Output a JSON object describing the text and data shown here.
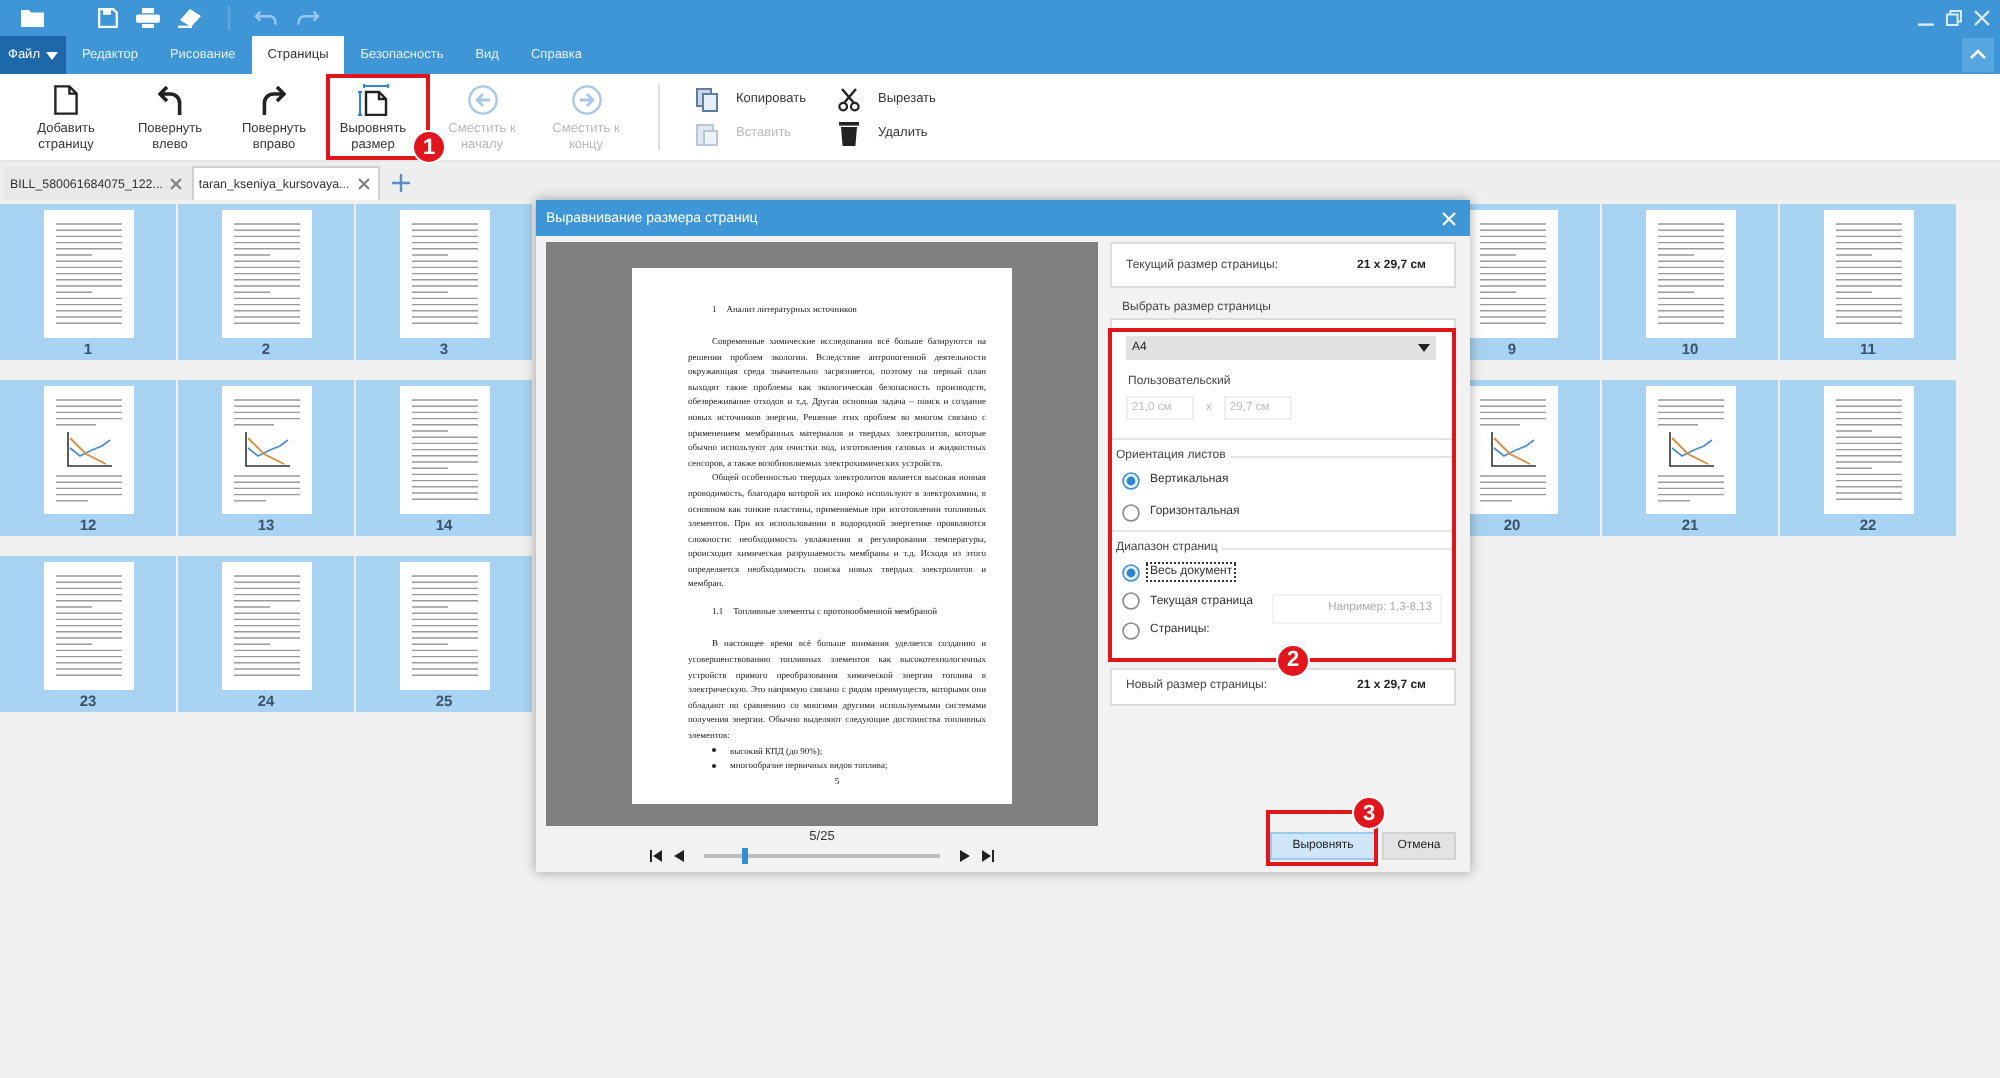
{
  "menu_tabs": [
    {
      "label": "Файл",
      "kind": "file",
      "selected": false
    },
    {
      "label": "Редактор",
      "kind": "tab",
      "selected": false
    },
    {
      "label": "Рисование",
      "kind": "tab",
      "selected": false
    },
    {
      "label": "Страницы",
      "kind": "tab",
      "selected": true
    },
    {
      "label": "Безопасность",
      "kind": "tab",
      "selected": false
    },
    {
      "label": "Вид",
      "kind": "tab",
      "selected": false
    },
    {
      "label": "Справка",
      "kind": "tab",
      "selected": false
    }
  ],
  "ribbon": {
    "large_buttons": [
      {
        "label": "Добавить страницу",
        "disabled": false
      },
      {
        "label": "Повернуть влево",
        "disabled": false
      },
      {
        "label": "Повернуть вправо",
        "disabled": false
      },
      {
        "label": "Выровнять размер",
        "disabled": false,
        "callout": "1"
      },
      {
        "label": "Сместить к началу",
        "disabled": true
      },
      {
        "label": "Сместить к концу",
        "disabled": true
      }
    ],
    "small_buttons": [
      {
        "label": "Копировать",
        "disabled": false
      },
      {
        "label": "Вставить",
        "disabled": true
      },
      {
        "label": "Вырезать",
        "disabled": false
      },
      {
        "label": "Удалить",
        "disabled": false
      }
    ]
  },
  "document_tabs": [
    {
      "label": "BILL_580061684075_122...",
      "selected": false
    },
    {
      "label": "taran_kseniya_kursovaya...",
      "selected": true
    }
  ],
  "thumbnail_rows": [
    {
      "pages": [
        {
          "label": "1",
          "kind": "text",
          "selected": true
        },
        {
          "label": "2",
          "kind": "text",
          "selected": true
        },
        {
          "label": "3",
          "kind": "text",
          "selected": true
        },
        {
          "label": "9",
          "kind": "text",
          "selected": true
        },
        {
          "label": "10",
          "kind": "text",
          "selected": true
        },
        {
          "label": "11",
          "kind": "text",
          "selected": true
        }
      ]
    },
    {
      "pages": [
        {
          "label": "12",
          "kind": "chart",
          "selected": true
        },
        {
          "label": "13",
          "kind": "chart",
          "selected": true
        },
        {
          "label": "14",
          "kind": "text",
          "selected": true
        },
        {
          "label": "20",
          "kind": "chart",
          "selected": true
        },
        {
          "label": "21",
          "kind": "chart",
          "selected": true
        },
        {
          "label": "22",
          "kind": "text",
          "selected": true
        }
      ]
    },
    {
      "pages": [
        {
          "label": "23",
          "kind": "text",
          "selected": true
        },
        {
          "label": "24",
          "kind": "text",
          "selected": true
        },
        {
          "label": "25",
          "kind": "text",
          "selected": true
        }
      ]
    }
  ],
  "dialog": {
    "title": "Выравнивание размера страниц",
    "preview": {
      "document": [
        {
          "kind": "heading",
          "number": "1",
          "text": "Анализ литературных источников"
        },
        {
          "kind": "paragraph",
          "text": "Современные химические исследования всё больше базируются на решении проблем экологии. Вследствие антропогенной деятельности окружающая среда значительно загрязняется, поэтому на первый план выходят такие проблемы как экологическая безопасность производств, обезвреживание отходов и т.д. Другая основная задача – поиск и создание новых источников энергии. Решение этих проблем во многом связано с применением мембранных материалов и твердых электролитов, которые обычно используют для очистки вод, изготовления газовых и жидкостных сенсоров, а также возобновляемых электрохимических устройств."
        },
        {
          "kind": "paragraph",
          "text": "Общей особенностью твердых электролитов является высокая ионная проводимость, благодаря которой их широко используют в электрохимии, в основном как тонкие пластины, применяемые при изготовлении топливных элементов. При их использовании в водородной энергетике проявляются сложности: необходимость увлажнения и регулирования температуры, происходит химическая разрушаемость мембраны и т.д. Исходя из этого определяется необходимость поиска новых твердых электролитов и мембран."
        },
        {
          "kind": "heading",
          "number": "1.1",
          "text": "Топливные элементы с протонообменной мембраной"
        },
        {
          "kind": "paragraph",
          "text": "В настоящее время всё больше внимания уделяется созданию и усовершенствованию топливных элементов как высокотехнологичных устройств прямого преобразования химической энергии топлива в электрическую. Это напрямую связано с рядом преимуществ, которыми они обладают по сравнению со многими другими используемыми системами получения энергии. Обычно выделяют следующие достоинства топливных элементов:"
        },
        {
          "kind": "bullet",
          "text": "высокий КПД (до 90%);"
        },
        {
          "kind": "bullet",
          "text": "многообразие первичных видов топлива;"
        },
        {
          "kind": "page_number",
          "text": "5"
        }
      ],
      "counter": "5/25",
      "slider": {
        "level": 0.17
      }
    },
    "current_size": {
      "label": "Текущий размер страницы:",
      "value": "21 x 29,7 см"
    },
    "settings": {
      "callout": "2",
      "size": {
        "label": "Выбрать размер страницы",
        "select": "A4",
        "custom": {
          "label": "Пользовательский",
          "disabled": true,
          "width": "21,0 см",
          "separator": "x",
          "height": "29,7 см"
        }
      },
      "orientation": {
        "label": "Ориентация листов",
        "options": [
          {
            "label": "Вертикальная",
            "selected": true
          },
          {
            "label": "Горизонтальная",
            "selected": false
          }
        ]
      },
      "range": {
        "label": "Диапазон страниц",
        "options": [
          {
            "label": "Весь документ",
            "selected": true,
            "focused": true
          },
          {
            "label": "Текущая страница",
            "selected": false,
            "focused": false
          },
          {
            "label": "Страницы:",
            "selected": false,
            "focused": false
          }
        ],
        "pages_field": {
          "placeholder": "Например: 1,3-8,13",
          "disabled": true
        }
      }
    },
    "new_size": {
      "label": "Новый размер страницы:",
      "value": "21 x 29,7 см"
    },
    "buttons": [
      {
        "label": "Выровнять",
        "kind": "primary",
        "callout": "3"
      },
      {
        "label": "Отмена",
        "kind": "secondary"
      }
    ]
  }
}
